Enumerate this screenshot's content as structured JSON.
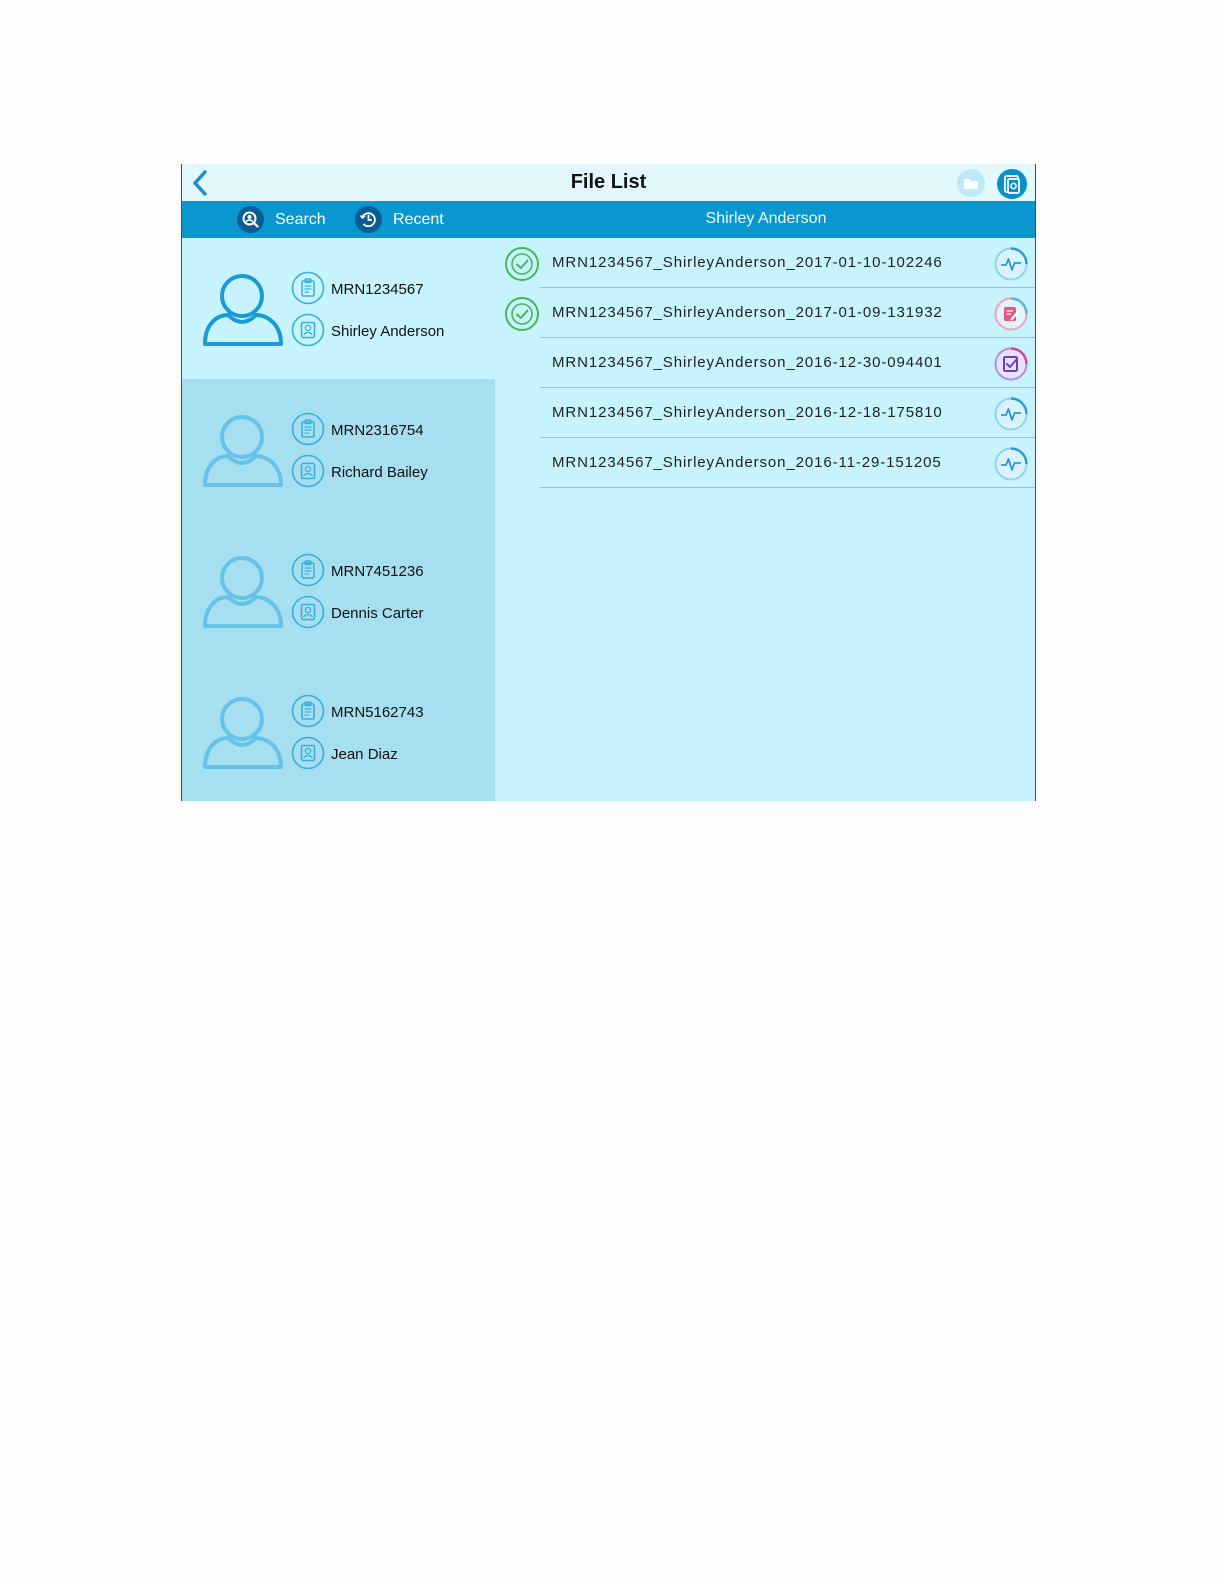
{
  "header": {
    "title": "File List"
  },
  "toolbar": {
    "search_label": "Search",
    "recent_label": "Recent",
    "selected_patient": "Shirley Anderson"
  },
  "colors": {
    "toolbar": "#0a96cf",
    "title_bar": "#e3f8fd",
    "panel": "#c7f4fc",
    "patient_list": "#a5dff0",
    "check": "#49b45b"
  },
  "patients": [
    {
      "mrn": "MRN1234567",
      "name": "Shirley Anderson",
      "selected": true
    },
    {
      "mrn": "MRN2316754",
      "name": "Richard Bailey",
      "selected": false
    },
    {
      "mrn": "MRN7451236",
      "name": "Dennis Carter",
      "selected": false
    },
    {
      "mrn": "MRN5162743",
      "name": "Jean Diaz",
      "selected": false
    }
  ],
  "files": [
    {
      "name": "MRN1234567_ShirleyAnderson_2017-01-10-102246",
      "checked": true,
      "type_icon": "ecg-icon"
    },
    {
      "name": "MRN1234567_ShirleyAnderson_2017-01-09-131932",
      "checked": true,
      "type_icon": "report-edit-icon"
    },
    {
      "name": "MRN1234567_ShirleyAnderson_2016-12-30-094401",
      "checked": false,
      "type_icon": "report-check-icon"
    },
    {
      "name": "MRN1234567_ShirleyAnderson_2016-12-18-175810",
      "checked": false,
      "type_icon": "ecg-icon"
    },
    {
      "name": "MRN1234567_ShirleyAnderson_2016-11-29-151205",
      "checked": false,
      "type_icon": "ecg-icon"
    }
  ]
}
